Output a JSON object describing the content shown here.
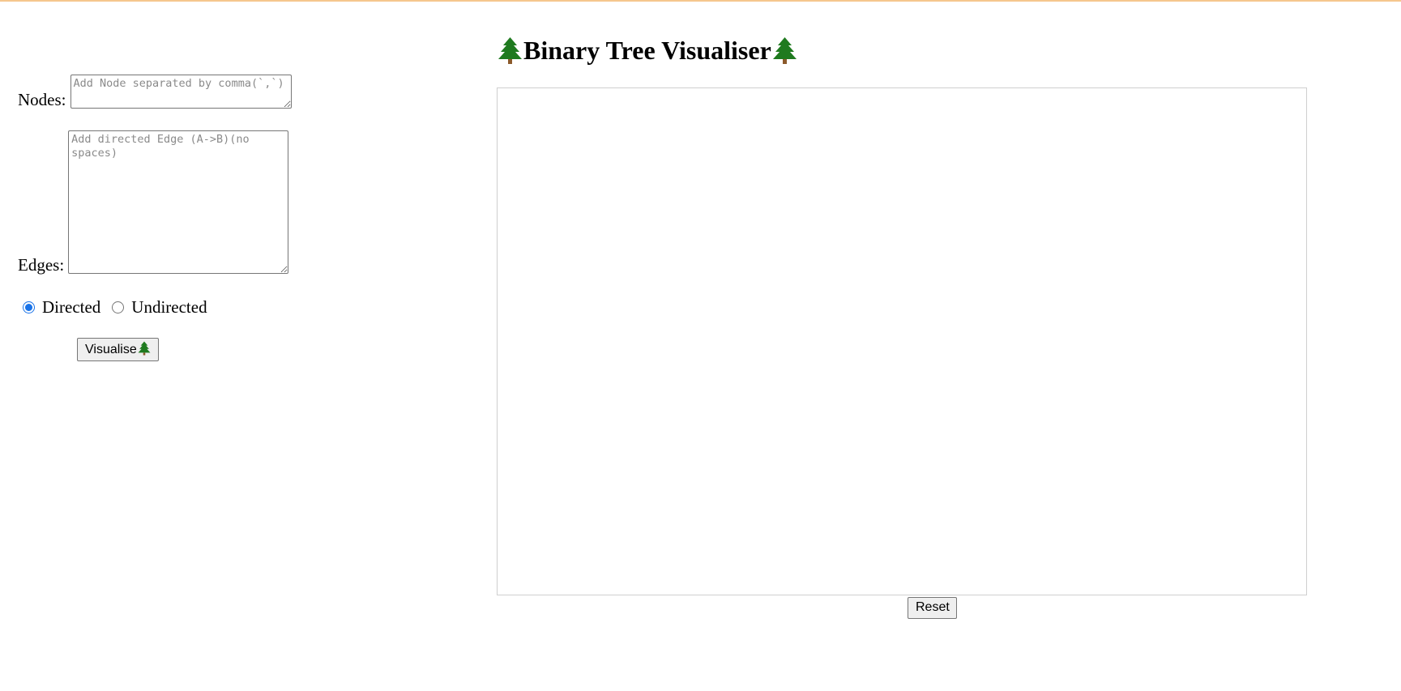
{
  "page": {
    "title": "Binary Tree Visualiser",
    "accent_line_color": "#f5c78e"
  },
  "form": {
    "nodes_label": "Nodes:",
    "nodes_placeholder": "Add Node separated by comma(`,`)",
    "nodes_value": "",
    "edges_label": "Edges:",
    "edges_placeholder": "Add directed Edge (A->B)(no spaces)",
    "edges_value": "",
    "graph_type": {
      "options": [
        "Directed",
        "Undirected"
      ],
      "selected": "Directed"
    },
    "visualise_label": "Visualise"
  },
  "canvas": {
    "reset_label": "Reset"
  },
  "icons": {
    "title_left": "evergreen-tree-icon",
    "title_right": "evergreen-tree-icon",
    "visualise": "evergreen-tree-icon",
    "tree_color": "#1f7a1f"
  }
}
